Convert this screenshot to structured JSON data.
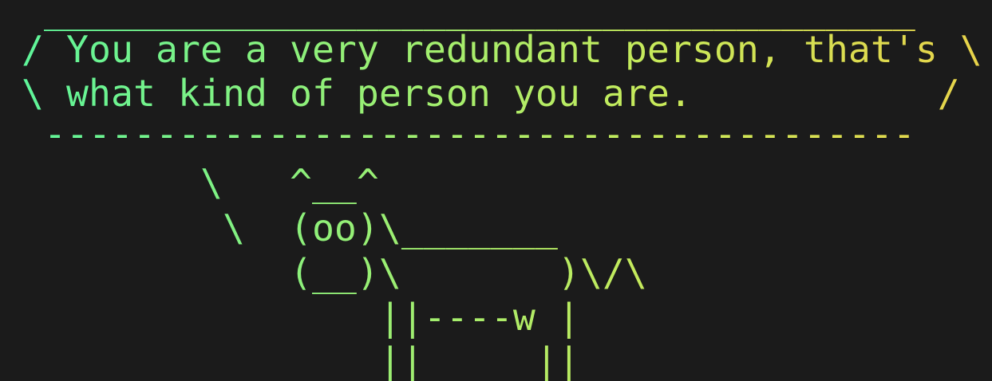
{
  "terminal": {
    "background": "#1b1b1b",
    "gradient_colors": [
      "#5ef59a",
      "#8ef07a",
      "#c8ea5a",
      "#e8d34a"
    ],
    "lines": [
      " _______________________________________",
      "/ You are a very redundant person, that's \\",
      "\\ what kind of person you are.           /",
      " ---------------------------------------",
      "        \\   ^__^",
      "         \\  (oo)\\_______",
      "            (__)\\       )\\/\\",
      "                ||----w |",
      "                ||     ||"
    ]
  }
}
